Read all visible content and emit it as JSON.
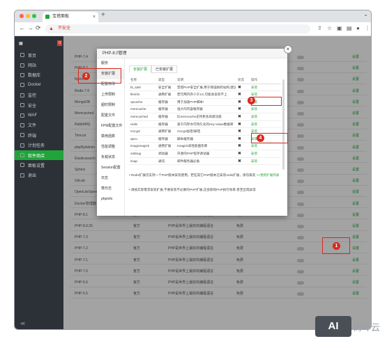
{
  "browser": {
    "tab_title": "宝塔面板",
    "tab_close": "×",
    "new_tab": "+",
    "tab_menu": "⌄",
    "url_warn": "▲",
    "url_insecure": "不安全",
    "url_text": "",
    "back": "←",
    "forward": "→",
    "reload": "⟳"
  },
  "sidebar": {
    "head_label": "",
    "head_badge": "0",
    "items": [
      {
        "label": "首页",
        "active": false
      },
      {
        "label": "网站",
        "active": false
      },
      {
        "label": "数据库",
        "active": false
      },
      {
        "label": "Docker",
        "active": false
      },
      {
        "label": "监控",
        "active": false
      },
      {
        "label": "安全",
        "active": false
      },
      {
        "label": "WAF",
        "active": false
      },
      {
        "label": "文件",
        "active": false
      },
      {
        "label": "终端",
        "active": false
      },
      {
        "label": "计划任务",
        "active": false
      },
      {
        "label": "软件商店",
        "active": true
      },
      {
        "label": "面板设置",
        "active": false
      },
      {
        "label": "退出",
        "active": false
      }
    ],
    "bottom": "≪"
  },
  "store_rows": [
    {
      "name": "PHP-7.4",
      "author": "官方",
      "desc": "",
      "price": "",
      "action": "设置"
    },
    {
      "name": "PHP-8.2",
      "author": "官方",
      "desc": "",
      "price": "",
      "action": "设置"
    },
    {
      "name": "Nginx",
      "author": "官方",
      "desc": "",
      "price": "",
      "action": "设置"
    },
    {
      "name": "Redis 7.0",
      "author": "官方",
      "desc": "",
      "price": "",
      "action": "设置"
    },
    {
      "name": "MongoDB",
      "author": "官方",
      "desc": "",
      "price": "",
      "action": "设置"
    },
    {
      "name": "Memcached",
      "author": "官方",
      "desc": "",
      "price": "",
      "action": "设置"
    },
    {
      "name": "RabbitMQ",
      "author": "官方",
      "desc": "",
      "price": "",
      "action": "设置"
    },
    {
      "name": "Tomcat",
      "author": "官方",
      "desc": "",
      "price": "",
      "action": "设置"
    },
    {
      "name": "phpMyAdmin",
      "author": "官方",
      "desc": "",
      "price": "",
      "action": "设置"
    },
    {
      "name": "Elasticsearch",
      "author": "官方",
      "desc": "",
      "price": "",
      "action": "设置"
    },
    {
      "name": "Sphinx",
      "author": "官方",
      "desc": "",
      "price": "",
      "action": "设置"
    },
    {
      "name": "GitLab",
      "author": "官方",
      "desc": "",
      "price": "",
      "action": "设置"
    },
    {
      "name": "OpenLiteSpeed",
      "author": "官方",
      "desc": "",
      "price": "",
      "action": "设置"
    },
    {
      "name": "Docker管理器",
      "author": "官方",
      "desc": "已不提供维护",
      "price": "免费",
      "action": "设置"
    },
    {
      "name": "PHP-8.1",
      "author": "官方",
      "desc": "PHP是世界上最好的编程语言",
      "price": "免费",
      "action": "设置"
    },
    {
      "name": "PHP-8.0.26",
      "author": "官方",
      "desc": "PHP是世界上最好的编程语言",
      "price": "免费",
      "action": "设置"
    },
    {
      "name": "PHP-7.3",
      "author": "官方",
      "desc": "PHP是世界上最好的编程语言",
      "price": "免费",
      "action": "设置"
    },
    {
      "name": "PHP-7.2",
      "author": "官方",
      "desc": "PHP是世界上最好的编程语言",
      "price": "免费",
      "action": "设置"
    },
    {
      "name": "PHP-7.1",
      "author": "官方",
      "desc": "PHP是世界上最好的编程语言",
      "price": "免费",
      "action": "设置"
    },
    {
      "name": "PHP-7.0",
      "author": "官方",
      "desc": "PHP是世界上最好的编程语言",
      "price": "免费",
      "action": "设置"
    },
    {
      "name": "PHP-5.6",
      "author": "官方",
      "desc": "PHP是世界上最好的编程语言",
      "price": "免费",
      "action": "设置"
    },
    {
      "name": "PHP-5.5",
      "author": "官方",
      "desc": "PHP是世界上最好的编程语言",
      "price": "免费",
      "action": "设置"
    }
  ],
  "modal": {
    "title": "PHP-8.0管理",
    "close": "×",
    "side_items": [
      "服务",
      "安装扩展",
      "配置修改",
      "上传限制",
      "超时限制",
      "配置文件",
      "FPM配置文件",
      "禁用函数",
      "性能调整",
      "负载状态",
      "Session配置",
      "日志",
      "慢日志",
      "phpinfo"
    ],
    "tabs": [
      "安装扩展",
      "已安装扩展"
    ],
    "headers": [
      "名称",
      "类型",
      "说明",
      "状态",
      "操作"
    ],
    "rows": [
      {
        "name": "bt_safe",
        "type": "安全扩展",
        "desc": "堡塔PHP安全扩展,用于增强防跨站和,建议Nginx/Apache用户安装",
        "status": "✖",
        "op": "安装"
      },
      {
        "name": "fileinfo",
        "type": "通用扩展",
        "desc": "若可用内存小于1G,可能会安装不上",
        "status": "✖",
        "op": "安装"
      },
      {
        "name": "opcache",
        "type": "缓存器",
        "desc": "用于加速PHP脚本!",
        "status": "✖",
        "op": "安装"
      },
      {
        "name": "memcache",
        "type": "缓存器",
        "desc": "强大的内容缓存器",
        "status": "✖",
        "op": "安装"
      },
      {
        "name": "memcached",
        "type": "缓存器",
        "desc": "比memcache支持更多高级功能",
        "status": "✖",
        "op": "安装"
      },
      {
        "name": "redis",
        "type": "缓存器",
        "desc": "基于内存亦可持久化的Key-Value数据库",
        "status": "✖",
        "op": "安装"
      },
      {
        "name": "mcrypt",
        "type": "通用扩展",
        "desc": "mcrypt加密/解密",
        "status": "✖",
        "op": "安装"
      },
      {
        "name": "apcu",
        "type": "缓存器",
        "desc": "脚本缓存器",
        "status": "✖",
        "op": "安装"
      },
      {
        "name": "imagemagick",
        "type": "通用扩展",
        "desc": "Imagick高性能图形库",
        "status": "✖",
        "op": "安装"
      },
      {
        "name": "xdebug",
        "type": "调试器",
        "desc": "开源的PHP程序调试器",
        "status": "✖",
        "op": "安装"
      },
      {
        "name": "imap",
        "type": "通讯",
        "desc": "邮件服务器必备",
        "status": "✖",
        "op": "安装"
      }
    ],
    "note1": "Redis扩展仅支持一个PHP版本安装使用，若在其它PHP版本已安装redis扩展，请勿再装",
    "note1_link": ">>更新扩展列表",
    "note2": "请按实际需求安装扩展,不要安装不必要的PHP扩展,这会影响PHP执行效率,甚至出现异常"
  },
  "callouts": [
    "1",
    "2",
    "3",
    "4"
  ],
  "colors": {
    "accent": "#20a53a",
    "callout": "#d9291c",
    "sidebar": "#2c3138"
  },
  "watermark": {
    "logo": "AI",
    "text": "树叶云"
  }
}
